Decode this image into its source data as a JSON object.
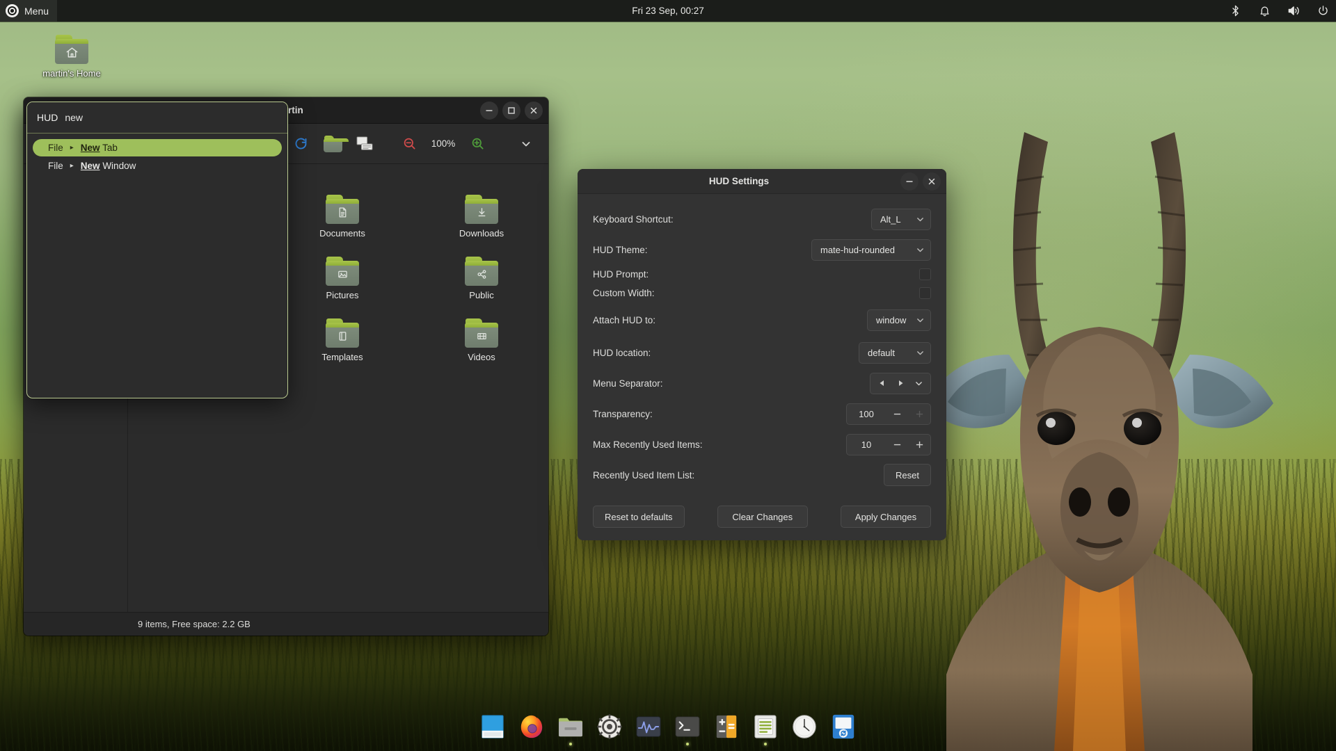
{
  "panel": {
    "menu_label": "Menu",
    "menu_icon": "ubuntu-logo-icon",
    "clock": "Fri 23 Sep, 00:27",
    "tray": [
      {
        "name": "bluetooth-icon",
        "title": "Bluetooth"
      },
      {
        "name": "notification-bell-icon",
        "title": "Notifications"
      },
      {
        "name": "volume-icon",
        "title": "Volume"
      },
      {
        "name": "power-icon",
        "title": "Power"
      }
    ]
  },
  "desktop": {
    "home_icon": {
      "label": "martin's Home",
      "icon": "home-folder-icon"
    }
  },
  "filemanager": {
    "title": "rtin",
    "toolbar": {
      "reload_icon": "reload-icon",
      "home_icon": "home-folder-icon",
      "computer_icon": "computer-icon",
      "zoom_out_icon": "zoom-out-icon",
      "zoom_level": "100%",
      "zoom_in_icon": "zoom-in-icon",
      "overflow_icon": "chevron-down-icon"
    },
    "window_buttons": {
      "minimize": "minimize-icon",
      "maximize": "maximize-icon",
      "close": "close-icon"
    },
    "items": [
      {
        "label": "Documents",
        "icon": "document-folder-icon"
      },
      {
        "label": "Downloads",
        "icon": "download-folder-icon"
      },
      {
        "label": "Pictures",
        "icon": "pictures-folder-icon"
      },
      {
        "label": "Public",
        "icon": "public-share-folder-icon"
      },
      {
        "label": "Templates",
        "icon": "templates-folder-icon"
      },
      {
        "label": "Videos",
        "icon": "videos-folder-icon"
      }
    ],
    "status": "9 items, Free space: 2.2 GB"
  },
  "hud": {
    "tag": "HUD",
    "query": "new",
    "results": [
      {
        "context": "File",
        "arrow": "▸",
        "match": "New",
        "rest": " Tab",
        "selected": true
      },
      {
        "context": "File",
        "arrow": "▸",
        "match": "New",
        "rest": " Window",
        "selected": false
      }
    ],
    "accent_color": "#9ebf5b",
    "border_color": "#b9c98f"
  },
  "hud_settings": {
    "title": "HUD Settings",
    "window_buttons": {
      "minimize": "minimize-icon",
      "close": "close-icon"
    },
    "rows": [
      {
        "label": "Keyboard Shortcut:",
        "control": "combo",
        "value": "Alt_L"
      },
      {
        "label": "HUD Theme:",
        "control": "combo",
        "value": "mate-hud-rounded"
      },
      {
        "label": "HUD Prompt:",
        "control": "checkbox",
        "value": ""
      },
      {
        "label": "Custom Width:",
        "control": "checkbox",
        "value": ""
      },
      {
        "label": "Attach HUD to:",
        "control": "combo",
        "value": "window"
      },
      {
        "label": "HUD location:",
        "control": "combo",
        "value": "default"
      },
      {
        "label": "Menu Separator:",
        "control": "separator",
        "value": ""
      },
      {
        "label": "Transparency:",
        "control": "spin",
        "value": "100"
      },
      {
        "label": "Max Recently Used Items:",
        "control": "spin",
        "value": "10"
      },
      {
        "label": "Recently Used Item List:",
        "control": "button",
        "value": "Reset"
      }
    ],
    "actions": [
      {
        "label": "Reset to defaults"
      },
      {
        "label": "Clear Changes"
      },
      {
        "label": "Apply Changes"
      }
    ]
  },
  "dock": {
    "items": [
      {
        "name": "dock-item-window-switcher",
        "icon": "blue-window-icon",
        "running": false
      },
      {
        "name": "dock-item-firefox",
        "icon": "firefox-icon",
        "running": false
      },
      {
        "name": "dock-item-files",
        "icon": "file-manager-icon",
        "running": true
      },
      {
        "name": "dock-item-settings",
        "icon": "gear-icon",
        "running": false
      },
      {
        "name": "dock-item-system-monitor",
        "icon": "system-monitor-icon",
        "running": false
      },
      {
        "name": "dock-item-terminal",
        "icon": "terminal-icon",
        "running": true
      },
      {
        "name": "dock-item-calculator",
        "icon": "calculator-icon",
        "running": false
      },
      {
        "name": "dock-item-text-editor",
        "icon": "text-editor-icon",
        "running": true
      },
      {
        "name": "dock-item-clock",
        "icon": "clock-icon",
        "running": false
      },
      {
        "name": "dock-item-backup",
        "icon": "backup-tool-icon",
        "running": false
      }
    ]
  }
}
